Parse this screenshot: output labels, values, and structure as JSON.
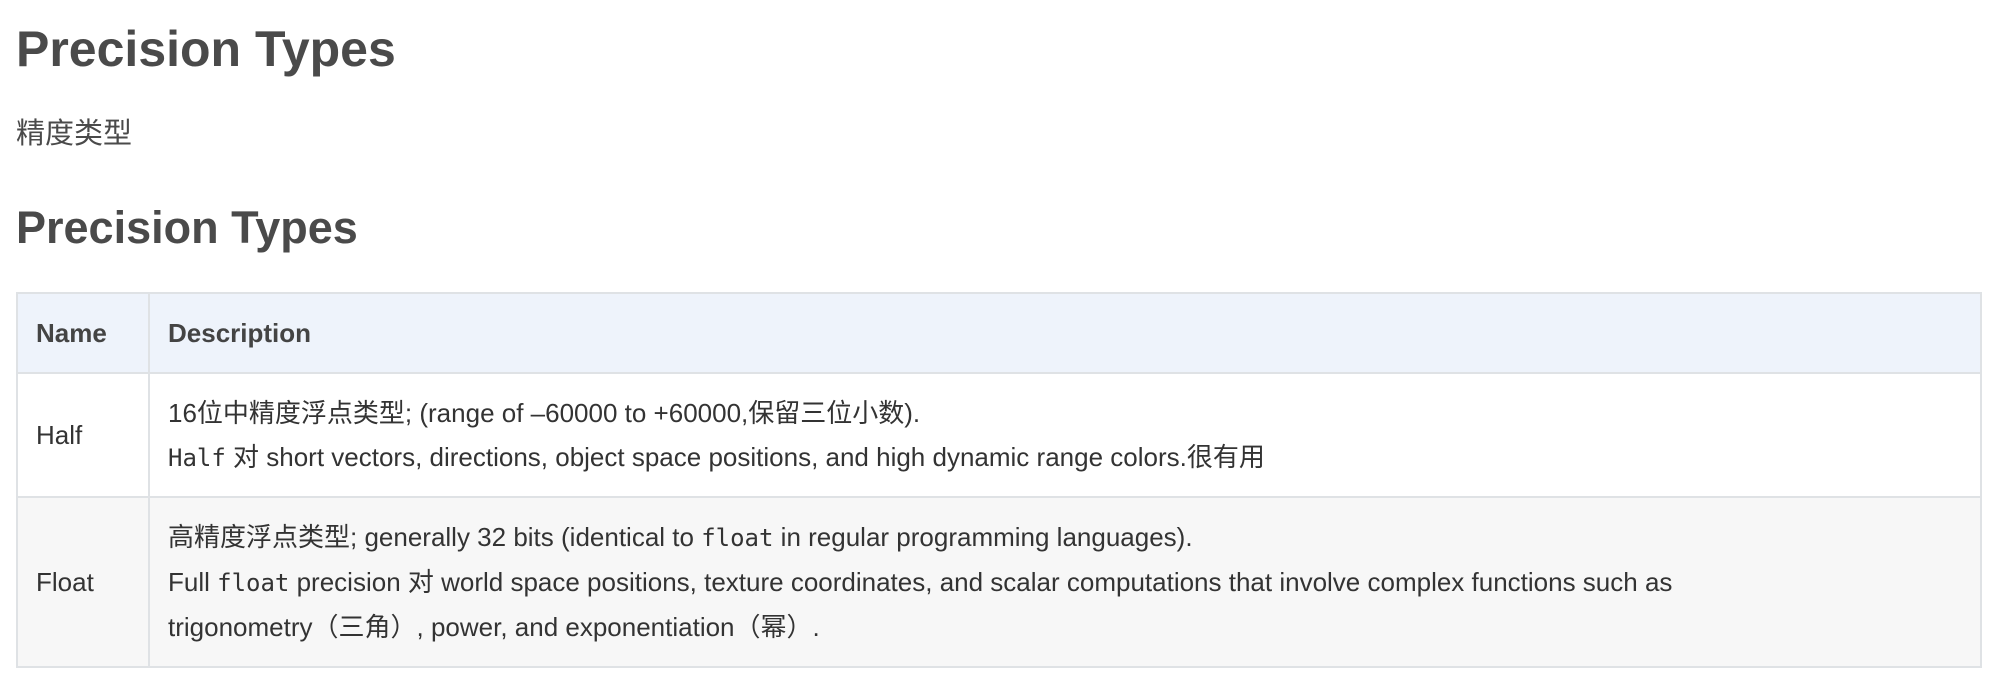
{
  "page": {
    "title": "Precision Types",
    "subtitle": "精度类型",
    "section_heading": "Precision Types"
  },
  "table": {
    "headers": {
      "name": "Name",
      "description": "Description"
    },
    "rows": [
      {
        "name": "Half",
        "line1": "16位中精度浮点类型; (range of –60000 to +60000,保留三位小数).",
        "line2_code": "Half",
        "line2_rest": " 对 short vectors, directions, object space positions, and high dynamic range colors.很有用"
      },
      {
        "name": "Float",
        "line1_pre": "高精度浮点类型; generally 32 bits (identical to ",
        "line1_code": "float",
        "line1_post": " in regular programming languages).",
        "line2_pre": "Full ",
        "line2_code": "float",
        "line2_post": " precision 对 world space positions, texture coordinates, and scalar computations that involve complex functions such as",
        "line3": "trigonometry（三角）, power, and exponentiation（幂）."
      }
    ]
  },
  "colors": {
    "header_bg": "#eef3fb",
    "alt_row_bg": "#f7f7f7",
    "border": "#dfe2e5",
    "heading_text": "#4a4a4a",
    "body_text": "#333333"
  }
}
